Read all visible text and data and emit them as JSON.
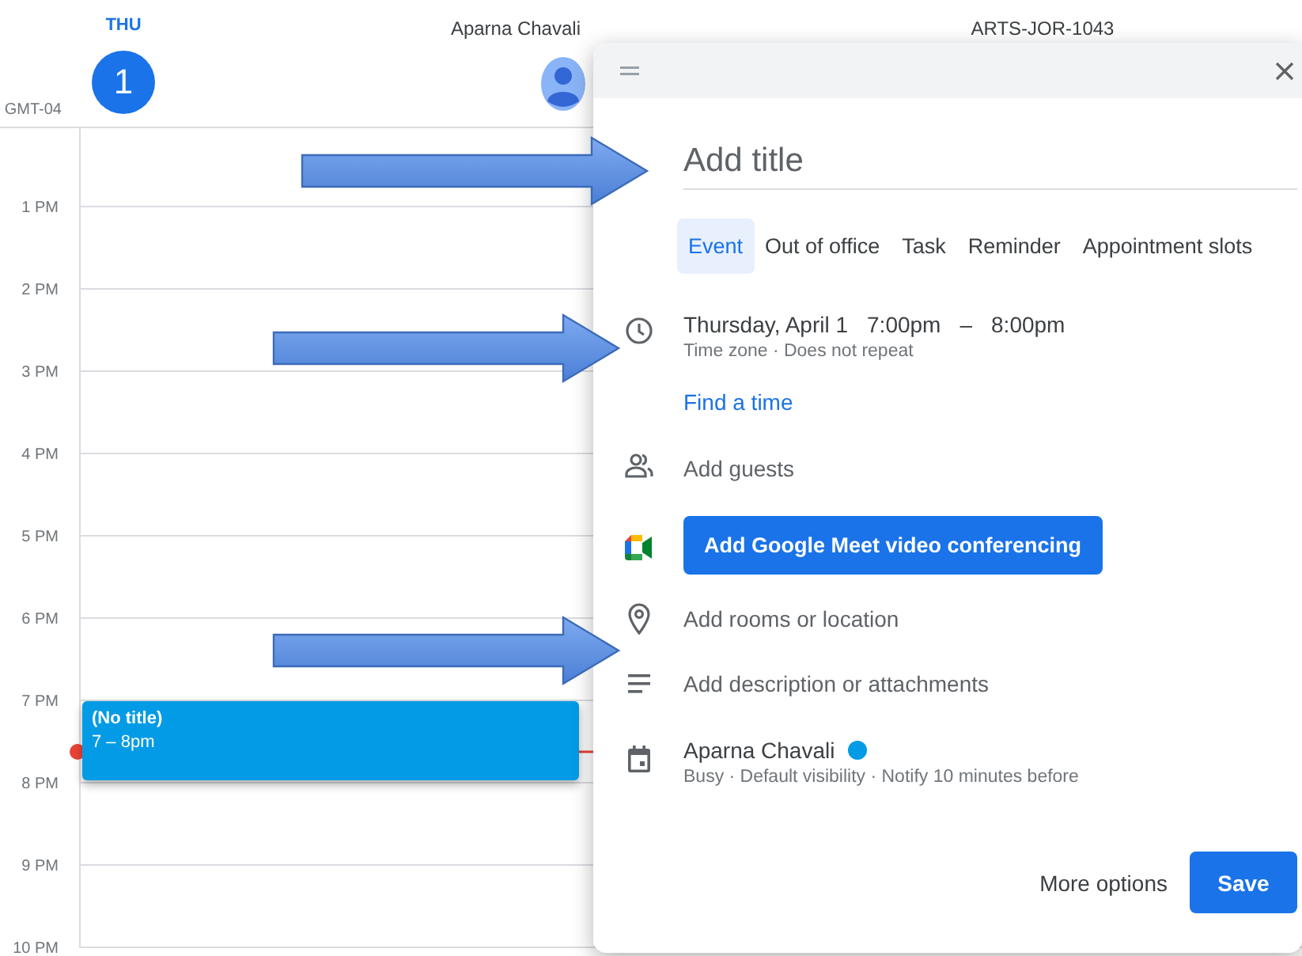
{
  "calendar": {
    "day_name": "THU",
    "day_number": "1",
    "user_name": "Aparna Chavali",
    "second_column": "ARTS-JOR-1043",
    "timezone": "GMT-04",
    "hours": [
      "1 PM",
      "2 PM",
      "3 PM",
      "4 PM",
      "5 PM",
      "6 PM",
      "7 PM",
      "8 PM",
      "9 PM",
      "10 PM"
    ],
    "event": {
      "title": "(No title)",
      "time": "7 – 8pm"
    }
  },
  "dialog": {
    "title_field": {
      "placeholder": "Add title"
    },
    "tabs": [
      {
        "label": "Event",
        "selected": true
      },
      {
        "label": "Out of office",
        "selected": false
      },
      {
        "label": "Task",
        "selected": false
      },
      {
        "label": "Reminder",
        "selected": false
      },
      {
        "label": "Appointment slots",
        "selected": false
      }
    ],
    "date": "Thursday, April 1",
    "start_time": "7:00pm",
    "time_separator": "–",
    "end_time": "8:00pm",
    "time_details": "Time zone · Does not repeat",
    "find_time": "Find a time",
    "guests": {
      "placeholder": "Add guests"
    },
    "meet_button": "Add Google Meet video conferencing",
    "location": {
      "placeholder": "Add rooms or location"
    },
    "description": {
      "placeholder": "Add description or attachments"
    },
    "calendar_owner": {
      "name": "Aparna Chavali",
      "color": "#039be5"
    },
    "owner_details": "Busy · Default visibility · Notify 10 minutes before",
    "more_options": "More options",
    "save": "Save"
  }
}
